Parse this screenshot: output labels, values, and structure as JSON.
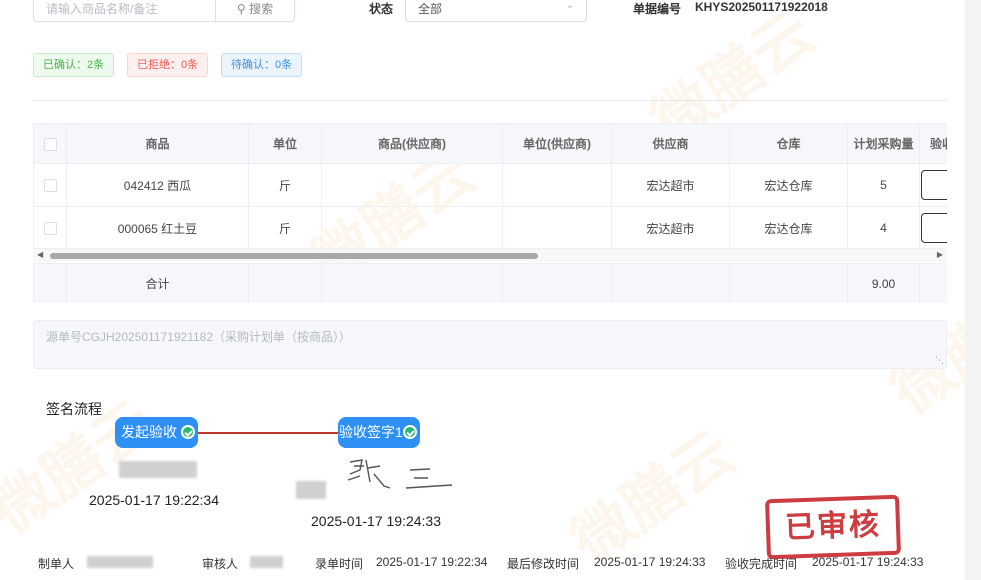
{
  "filters": {
    "search_placeholder": "请输入商品名称/备注",
    "search_button": "搜索",
    "status_label": "状态",
    "status_value": "全部",
    "billno_label": "单据编号",
    "billno_value": "KHYS20250117192201​8"
  },
  "tags": {
    "confirmed": "已确认：2条",
    "rejected": "已拒绝：0条",
    "pending": "待确认：0条"
  },
  "table": {
    "headers": [
      "商品",
      "单位",
      "商品(供应商)",
      "单位(供应商)",
      "供应商",
      "仓库",
      "计划采购量",
      "验收"
    ],
    "rows": [
      {
        "goods": "042412 西瓜",
        "unit": "斤",
        "goods_sup": "",
        "unit_sup": "",
        "supplier": "宏达超市",
        "warehouse": "宏达仓库",
        "plan_qty": "5"
      },
      {
        "goods": "000065 红土豆",
        "unit": "斤",
        "goods_sup": "",
        "unit_sup": "",
        "supplier": "宏达超市",
        "warehouse": "宏达仓库",
        "plan_qty": "4"
      }
    ],
    "total_label": "合计",
    "total_plan_qty": "9.00"
  },
  "remark": "源单号CGJH202501171921182（采购计划单（按商品））",
  "sign_flow": {
    "title": "签名流程",
    "nodes": [
      {
        "label": "发起验收",
        "time": "2025-01-17 19:22:34"
      },
      {
        "label": "验收签字1",
        "time": "2025-01-17 19:24:33"
      }
    ]
  },
  "footer": {
    "maker_label": "制单人",
    "reviewer_label": "审核人",
    "entry_time_label": "录单时间",
    "entry_time": "2025-01-17 19:22:34",
    "modified_label": "最后修改时间",
    "modified_time": "2025-01-17 19:24:33",
    "accept_label": "验收完成时间",
    "accept_time": "2025-01-17 19:24:33"
  },
  "stamp": "已审核",
  "watermark": "微膳云",
  "colors": {
    "primary": "#2e8ff5",
    "stamp": "#c7282c",
    "link_line": "#c0392b",
    "success": "#2bb673"
  }
}
